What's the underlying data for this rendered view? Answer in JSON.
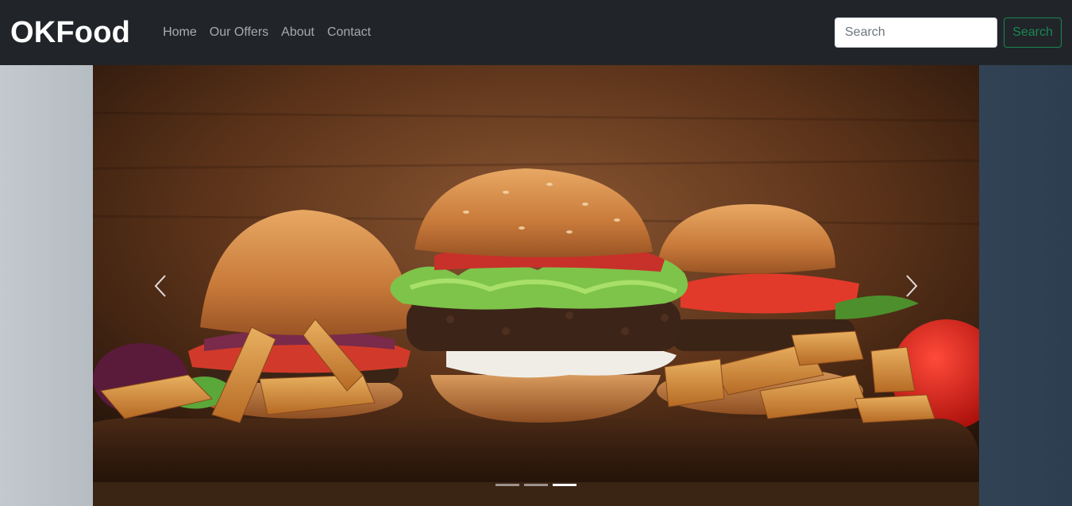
{
  "navbar": {
    "brand": "OKFood",
    "links": [
      "Home",
      "Our Offers",
      "About",
      "Contact"
    ],
    "search": {
      "placeholder": "Search",
      "button_label": "Search"
    }
  },
  "carousel": {
    "slide_image": "burgers-and-fries-photo",
    "prev_icon": "chevron-left-icon",
    "next_icon": "chevron-right-icon",
    "slide_count": 3,
    "active_slide": 3
  },
  "colors": {
    "navbar_bg": "#212529",
    "brand": "#ffffff",
    "search_button": "#198754"
  }
}
